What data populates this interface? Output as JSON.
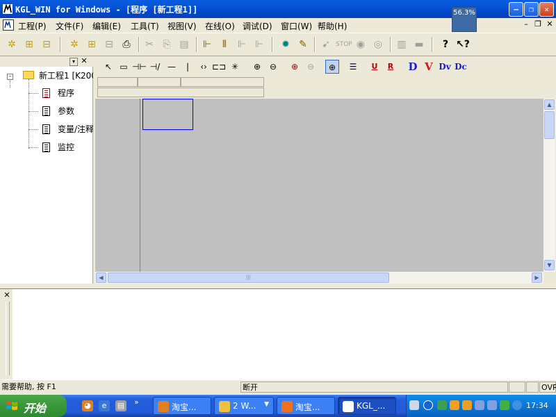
{
  "window": {
    "title": "KGL_WIN for Windows - [程序 [新工程1]]",
    "zoom_badge": "56.3%"
  },
  "menu": {
    "items": [
      "工程(P)",
      "文件(F)",
      "编辑(E)",
      "工具(T)",
      "视图(V)",
      "在线(O)",
      "调试(D)",
      "窗口(W)",
      "帮助(H)"
    ]
  },
  "tree": {
    "root": "新工程1 [K200",
    "children": [
      "程序",
      "参数",
      "变量/注释",
      "监控"
    ]
  },
  "status": {
    "help": "需要帮助, 按 F1",
    "connection": "断开",
    "mode": "OVR"
  },
  "taskbar": {
    "start_label": "开始",
    "tasks": [
      "淘宝...",
      "2 W...",
      "淘宝...",
      "KGL_..."
    ],
    "clock": "17:34"
  },
  "colors": {
    "titlebar": "#0553d6",
    "editor_bg": "#c0c0c0",
    "cursor_box": "#0000ff",
    "taskbar": "#245edc",
    "start_button": "#3c9a3c"
  }
}
